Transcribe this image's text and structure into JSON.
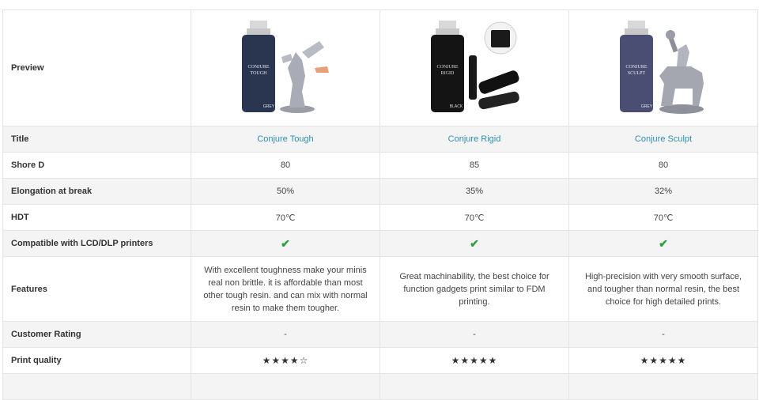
{
  "rows": {
    "preview": "Preview",
    "title": "Title",
    "shore": "Shore D",
    "elongation": "Elongation at break",
    "hdt": "HDT",
    "compatible": "Compatible with LCD/DLP printers",
    "features": "Features",
    "rating": "Customer Rating",
    "quality": "Print quality"
  },
  "products": [
    {
      "bottle_text_line1": "CONJURE",
      "bottle_text_line2": "TOUGH",
      "bottle_color_label": "GREY",
      "bottle_color": "#2a3550",
      "title": "Conjure Tough",
      "shore": "80",
      "elongation": "50%",
      "hdt": "70℃",
      "compatible_icon": "check-icon",
      "features": "With excellent toughness make your minis real non brittle. it is affordable than most other tough resin. and can mix with normal resin to make them tougher.",
      "rating": "-",
      "quality": "★★★★☆"
    },
    {
      "bottle_text_line1": "CONJURE",
      "bottle_text_line2": "RIGID",
      "bottle_color_label": "BLACK",
      "bottle_color": "#141414",
      "title": "Conjure Rigid",
      "shore": "85",
      "elongation": "35%",
      "hdt": "70℃",
      "compatible_icon": "check-icon",
      "features": "Great machinability, the best choice for function gadgets print similar to FDM printing.",
      "rating": "-",
      "quality": "★★★★★"
    },
    {
      "bottle_text_line1": "CONJURE",
      "bottle_text_line2": "SCULPT",
      "bottle_color_label": "GREY",
      "bottle_color": "#4a4e72",
      "title": "Conjure Sculpt",
      "shore": "80",
      "elongation": "32%",
      "hdt": "70℃",
      "compatible_icon": "check-icon",
      "features": "High-precision with very smooth surface, and tougher than normal resin, the best choice for high detailed prints.",
      "rating": "-",
      "quality": "★★★★★"
    }
  ],
  "colors": {
    "link": "#2f8fb3",
    "check": "#2e9e3f",
    "alt_row": "#f4f4f4"
  }
}
